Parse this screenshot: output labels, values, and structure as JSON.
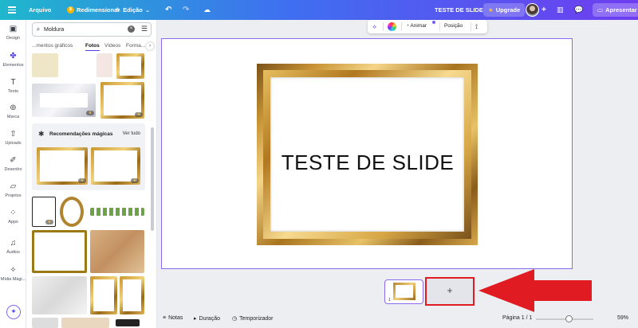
{
  "topbar": {
    "file_label": "Arquivo",
    "resize_label": "Redimensionar",
    "edit_label": "Edição",
    "doc_title": "TESTE DE SLIDE",
    "upgrade_label": "Upgrade",
    "present_label": "Apresentar"
  },
  "rail": {
    "items": [
      {
        "label": "Design",
        "icon": "design-icon"
      },
      {
        "label": "Elementos",
        "icon": "elements-icon"
      },
      {
        "label": "Texto",
        "icon": "text-icon"
      },
      {
        "label": "Marca",
        "icon": "brand-icon"
      },
      {
        "label": "Uploads",
        "icon": "upload-icon"
      },
      {
        "label": "Desenho",
        "icon": "draw-icon"
      },
      {
        "label": "Projetos",
        "icon": "folder-icon"
      },
      {
        "label": "Apps",
        "icon": "apps-icon"
      },
      {
        "label": "Áudios",
        "icon": "audio-icon"
      },
      {
        "label": "Mídia Mági...",
        "icon": "magic-media-icon"
      }
    ]
  },
  "panel": {
    "search_value": "Moldura",
    "tabs": [
      "...mentos gráficos",
      "Fotos",
      "Vídeos",
      "Forma..."
    ],
    "recommend_title": "Recomendações mágicas",
    "see_all": "Ver tudo"
  },
  "context_toolbar": {
    "animate_label": "Animar",
    "position_label": "Posição"
  },
  "canvas": {
    "slide_text": "TESTE DE SLIDE",
    "accent_color": "#8a6af0"
  },
  "pages": {
    "thumb_number": "1",
    "add_label": "+"
  },
  "bottombar": {
    "notes_label": "Notas",
    "duration_label": "Duração",
    "timer_label": "Temporizador",
    "page_label": "Página 1 / 1",
    "zoom_label": "59%",
    "zoom_value": 59
  },
  "annotation": {
    "arrow_color": "#e01b22"
  }
}
